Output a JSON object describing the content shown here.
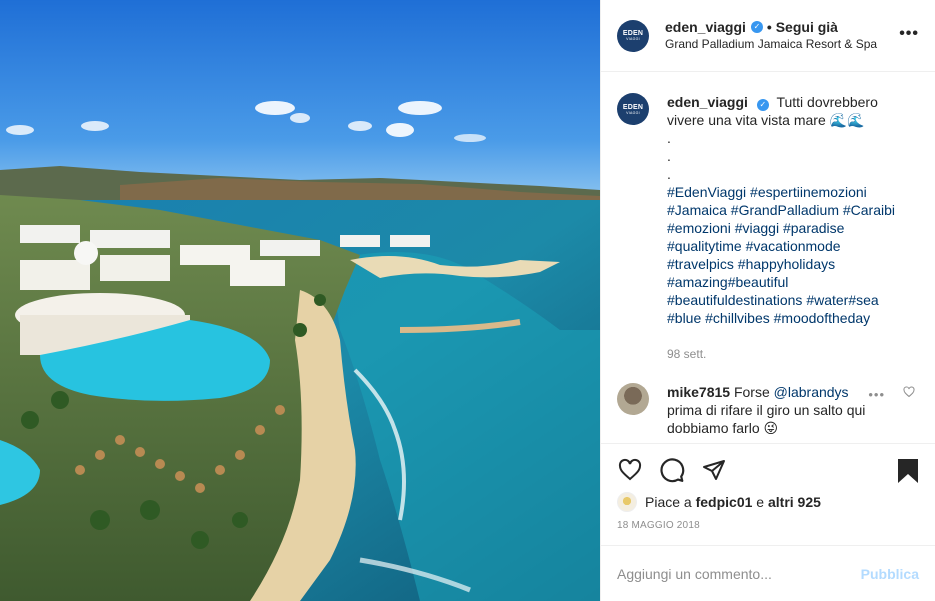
{
  "post": {
    "account": "eden_viaggi",
    "follow_status": "• Segui già",
    "location": "Grand Palladium Jamaica Resort & Spa",
    "logo_text": "EDEN",
    "logo_sub": "VIAGGI",
    "more_icon": "more-options-icon"
  },
  "caption": {
    "username": "eden_viaggi",
    "text": "Tutti dovrebbero vivere una vita vista mare 🌊🌊",
    "dots": [
      ".",
      ".",
      "."
    ],
    "hashtag_lines": [
      "#EdenViaggi #espertiinemozioni",
      "#Jamaica #GrandPalladium #Caraibi",
      "#emozioni #viaggi #paradise",
      "#qualitytime #vacationmode",
      "#travelpics #happyholidays",
      "#amazing#beautiful",
      "#beautifuldestinations #water#sea",
      "#blue #chillvibes #moodoftheday"
    ],
    "age": "98 sett."
  },
  "comment": {
    "username": "mike7815",
    "pre": "Forse",
    "mention": "@labrandys",
    "text": "prima di rifare il giro un salto qui dobbiamo farlo 😜"
  },
  "actions": {
    "likes_prefix": "Piace a",
    "liker": "fedpic01",
    "likes_mid": "e",
    "others": "altri 925",
    "date": "18 MAGGIO 2018"
  },
  "add_comment": {
    "placeholder": "Aggiungi un commento...",
    "publish_label": "Pubblica"
  },
  "colors": {
    "link": "#00376b",
    "verified": "#3897f0",
    "muted": "#8e8e8e",
    "publish_disabled": "#b3dbff"
  }
}
